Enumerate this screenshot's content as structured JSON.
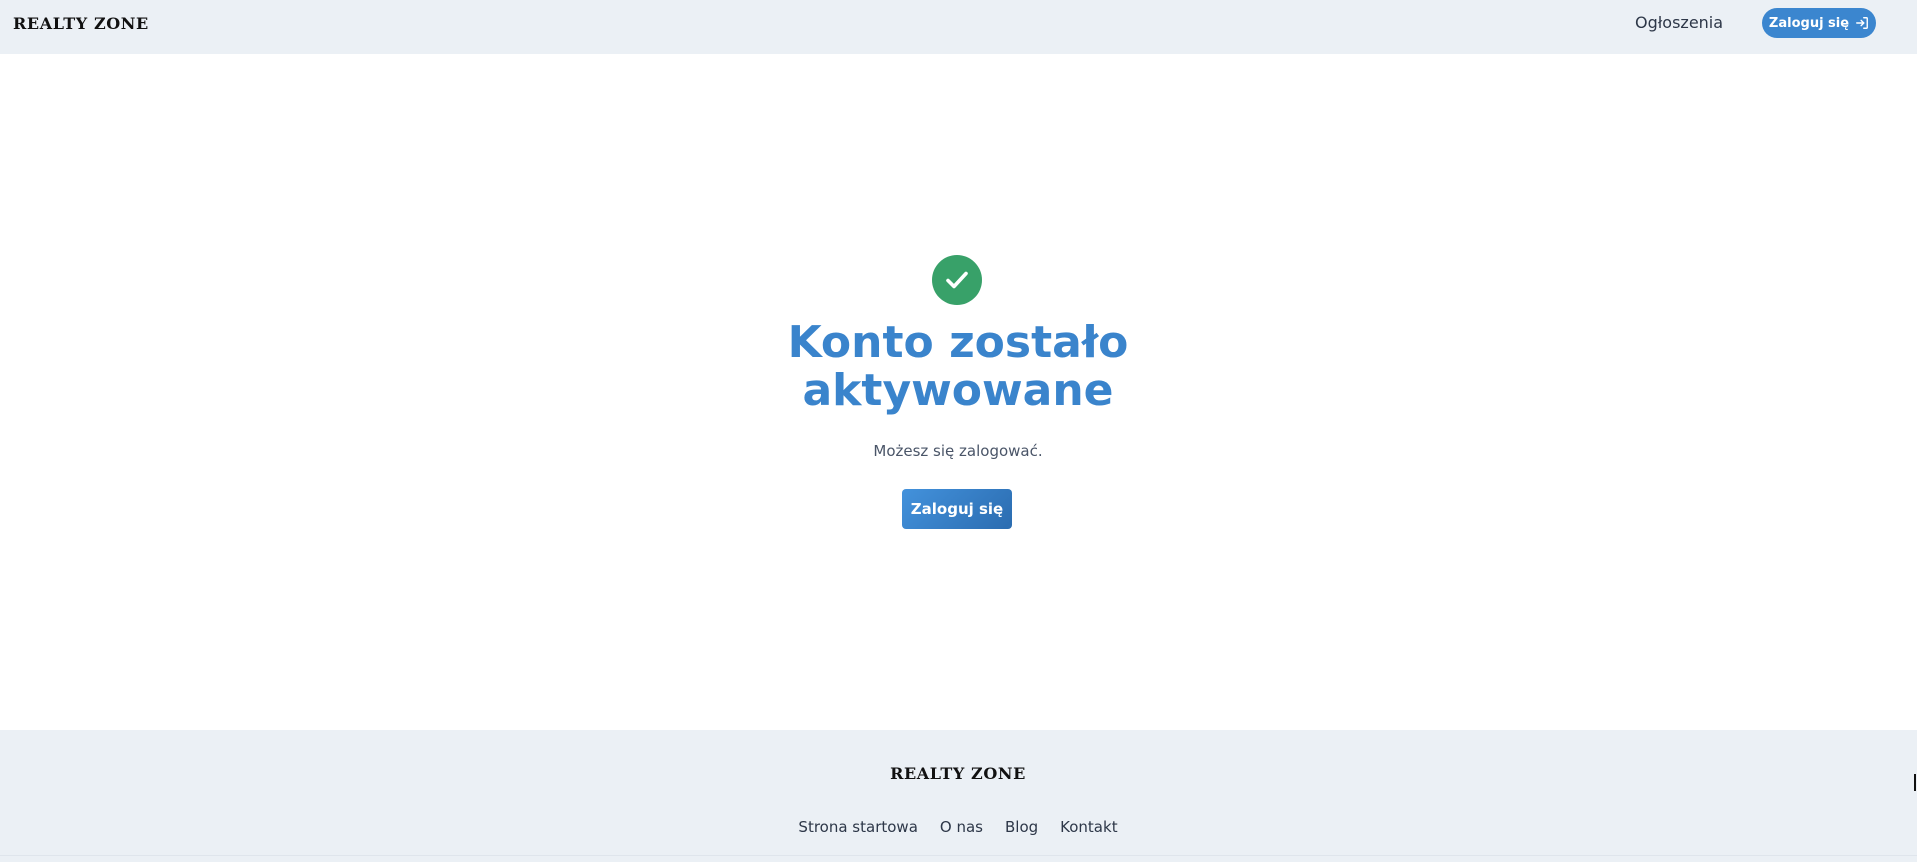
{
  "header": {
    "logo": "REALTY ZONE",
    "nav_link": "Ogłoszenia",
    "login_label": "Zaloguj się",
    "login_icon": "sign-in-icon"
  },
  "main": {
    "status_icon": "check-circle-icon",
    "title": "Konto zostało aktywowane",
    "subtitle": "Możesz się zalogować.",
    "login_button": "Zaloguj się"
  },
  "footer": {
    "logo": "REALTY ZONE",
    "links": [
      "Strona startowa",
      "O nas",
      "Blog",
      "Kontakt"
    ]
  },
  "colors": {
    "accent": "#3b86cf",
    "success": "#38a169",
    "header_bg": "#ebf0f5"
  }
}
